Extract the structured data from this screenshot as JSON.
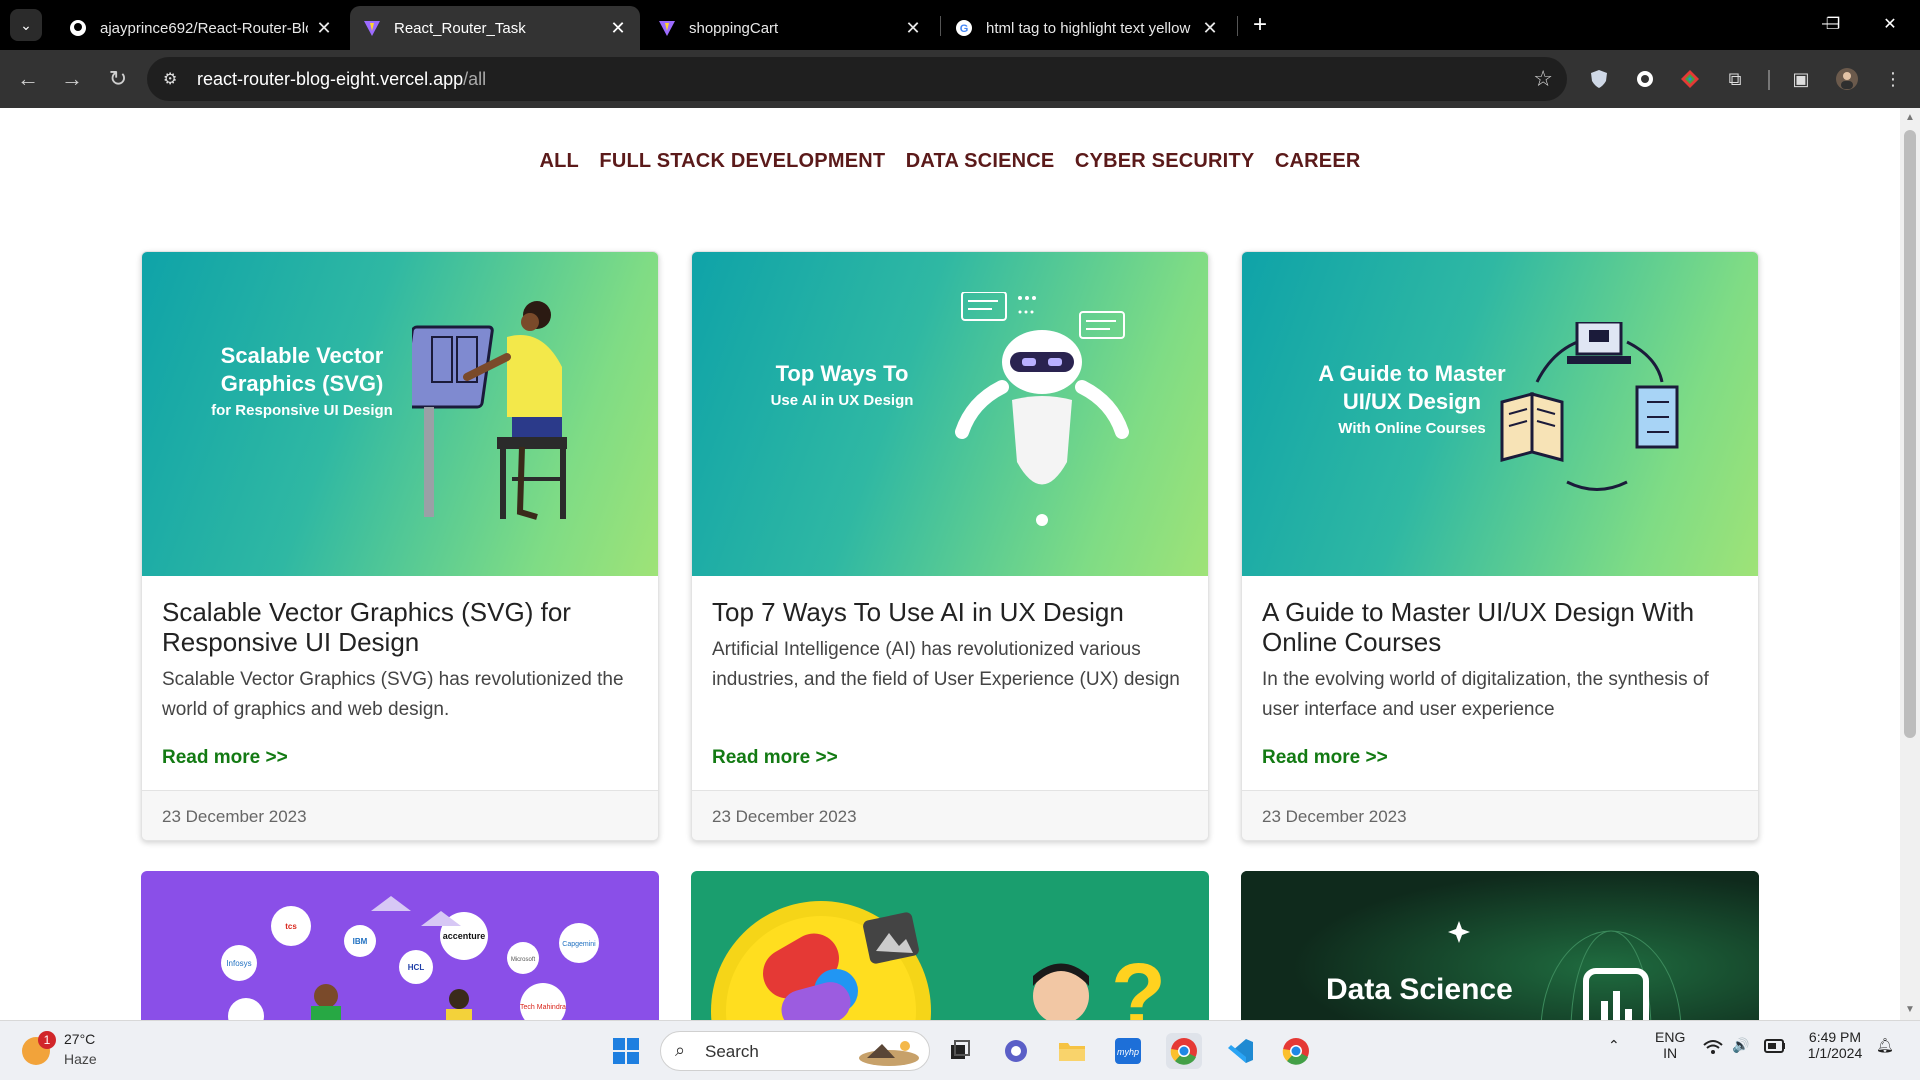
{
  "browser": {
    "tabs": [
      {
        "title": "ajayprince692/React-Router-Blo",
        "favicon": "github-icon",
        "active": false
      },
      {
        "title": "React_Router_Task",
        "favicon": "vite-icon",
        "active": true
      },
      {
        "title": "shoppingCart",
        "favicon": "vite-icon",
        "active": false
      },
      {
        "title": "html tag to highlight text yellow",
        "favicon": "google-icon",
        "active": false
      }
    ],
    "url_host": "react-router-blog-eight.vercel.app",
    "url_path": "/all"
  },
  "nav": {
    "items": [
      "ALL",
      "FULL STACK DEVELOPMENT",
      "DATA SCIENCE",
      "CYBER SECURITY",
      "CAREER"
    ]
  },
  "cards": [
    {
      "hero_title": "Scalable Vector Graphics (SVG)",
      "hero_sub": "for Responsive UI Design",
      "title": "Scalable Vector Graphics (SVG) for Responsive UI Design",
      "excerpt": "Scalable Vector Graphics (SVG) has revolutionized the world of graphics and web design.",
      "read_more": "Read more >>",
      "date": "23 December 2023"
    },
    {
      "hero_title": "Top Ways To",
      "hero_sub": "Use AI in UX Design",
      "title": "Top 7 Ways To Use AI in UX Design",
      "excerpt": "Artificial Intelligence (AI) has revolutionized various industries, and the field of User Experience (UX) design",
      "read_more": "Read more >>",
      "date": "23 December 2023"
    },
    {
      "hero_title": "A Guide to Master UI/UX Design",
      "hero_sub": "With Online Courses",
      "title": "A Guide to Master UI/UX Design With Online Courses",
      "excerpt": "In the evolving world of digitalization, the synthesis of user interface and user experience",
      "read_more": "Read more >>",
      "date": "23 December 2023"
    }
  ],
  "row2": {
    "logos": [
      "tcs",
      "IBM",
      "accenture",
      "Infosys",
      "HCL",
      "Microsoft",
      "Capgemini",
      "Tech Mahindra"
    ],
    "data_science_title": "Data Science"
  },
  "taskbar": {
    "weather_badge": "1",
    "temperature": "27°C",
    "condition": "Haze",
    "search_label": "Search",
    "lang_top": "ENG",
    "lang_bottom": "IN",
    "time": "6:49 PM",
    "date": "1/1/2024"
  }
}
